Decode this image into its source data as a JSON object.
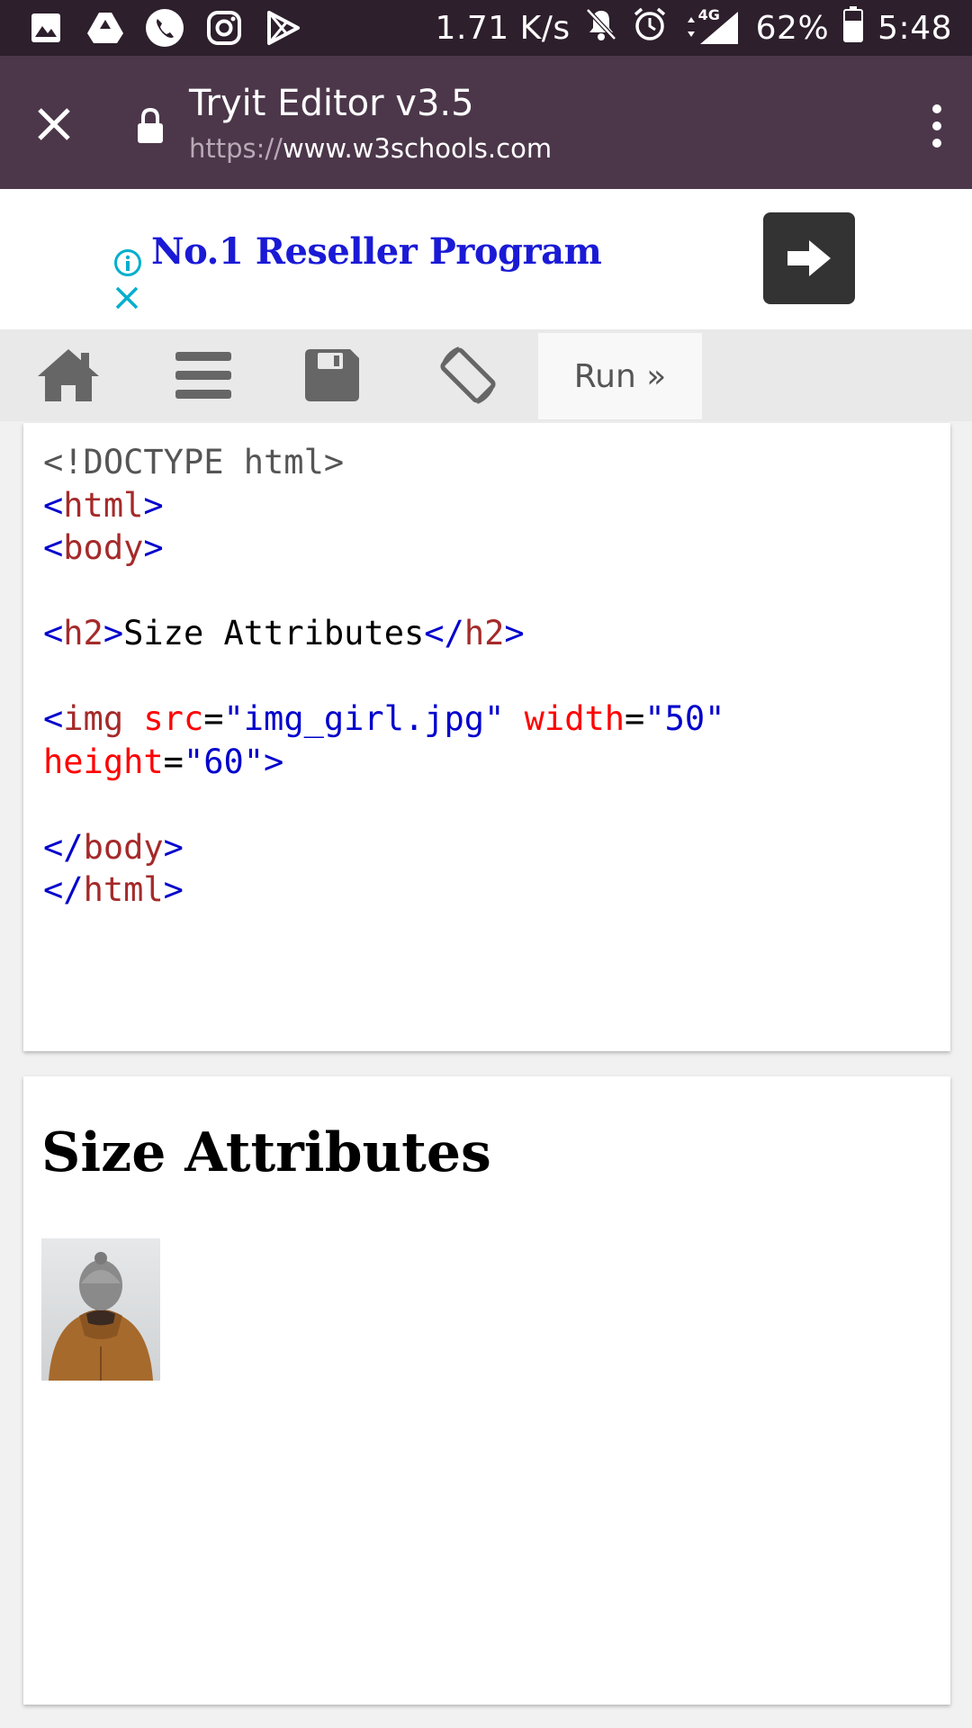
{
  "status_bar": {
    "net_speed": "1.71 K/s",
    "network": "4G",
    "battery": "62%",
    "time": "5:48",
    "icons": [
      "gallery-icon",
      "drive-icon",
      "phone-icon",
      "instagram-icon",
      "play-store-icon",
      "mute-icon",
      "alarm-icon",
      "signal-icon",
      "battery-icon"
    ]
  },
  "toolbar": {
    "title": "Tryit Editor v3.5",
    "url_scheme": "https://",
    "url_host": "www.w3schools.com"
  },
  "ad": {
    "text": "No.1 Reseller Program"
  },
  "editor_tools": {
    "run_label": "Run »"
  },
  "code": {
    "line1": "<!DOCTYPE html>",
    "html_open": "html",
    "body_open": "body",
    "h2_tag": "h2",
    "h2_text": "Size Attributes",
    "img_tag": "img",
    "attr_src": "src",
    "val_src": "\"img_girl.jpg\"",
    "attr_width": "width",
    "val_width": "\"50\"",
    "attr_height": "height",
    "val_height": "\"60\"",
    "body_close": "body",
    "html_close": "html"
  },
  "result": {
    "heading": "Size Attributes"
  },
  "colors": {
    "status_bar": "#2d1f2c",
    "toolbar": "#4c374a",
    "ad_link": "#1a1ad6",
    "tag_bracket": "#0000cd",
    "tag_name": "#a52a2a",
    "attribute": "#ff0000"
  }
}
